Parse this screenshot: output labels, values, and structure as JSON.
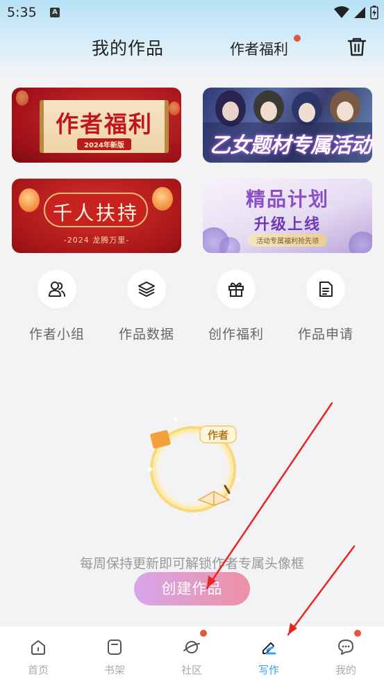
{
  "status_bar": {
    "time": "5:35",
    "notif_icon": "A"
  },
  "header": {
    "title": "我的作品",
    "welfare_label": "作者福利",
    "trash_icon": "trash-icon"
  },
  "banners": [
    {
      "title": "作者福利",
      "subtitle": "2024年新版"
    },
    {
      "title": "乙女题材专属活动"
    },
    {
      "title": "千人扶持",
      "subtitle": "-2024 龙腾万里-"
    },
    {
      "title": "精品计划",
      "subtitle": "升级上线",
      "tag": "活动专属福利抢先领"
    }
  ],
  "actions": [
    {
      "label": "作者小组",
      "icon": "group-icon"
    },
    {
      "label": "作品数据",
      "icon": "layers-icon"
    },
    {
      "label": "创作福利",
      "icon": "gift-icon"
    },
    {
      "label": "作品申请",
      "icon": "document-icon"
    }
  ],
  "empty_state": {
    "badge_text": "作者",
    "message": "每周保持更新即可解锁作者专属头像框",
    "button_label": "创建作品"
  },
  "tabbar": [
    {
      "label": "首页",
      "icon": "home-icon",
      "active": false,
      "badge": false
    },
    {
      "label": "书架",
      "icon": "bookshelf-icon",
      "active": false,
      "badge": false
    },
    {
      "label": "社区",
      "icon": "planet-icon",
      "active": false,
      "badge": true
    },
    {
      "label": "写作",
      "icon": "pen-icon",
      "active": true,
      "badge": false
    },
    {
      "label": "我的",
      "icon": "chat-icon",
      "active": false,
      "badge": true
    }
  ],
  "colors": {
    "accent": "#3a9ff5",
    "badge_red": "#e3563c",
    "button_start": "#d7a7ea",
    "button_end": "#ef8fa4",
    "annotation_arrow": "#e8241f"
  }
}
